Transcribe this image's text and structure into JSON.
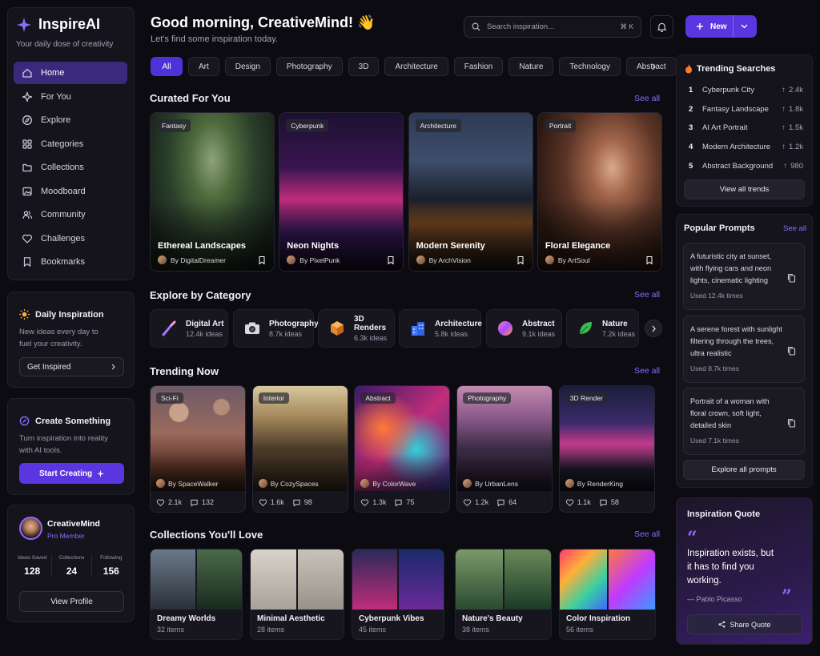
{
  "app": {
    "name": "InspireAI",
    "tagline": "Your daily dose of creativity"
  },
  "nav": [
    {
      "label": "Home",
      "icon": "home-icon",
      "active": true
    },
    {
      "label": "For You",
      "icon": "sparkle-icon"
    },
    {
      "label": "Explore",
      "icon": "compass-icon"
    },
    {
      "label": "Categories",
      "icon": "grid-icon"
    },
    {
      "label": "Collections",
      "icon": "folder-icon"
    },
    {
      "label": "Moodboard",
      "icon": "image-icon"
    },
    {
      "label": "Community",
      "icon": "users-icon"
    },
    {
      "label": "Challenges",
      "icon": "heart-icon"
    },
    {
      "label": "Bookmarks",
      "icon": "bookmark-icon"
    }
  ],
  "daily": {
    "title": "Daily Inspiration",
    "text1": "New ideas every day to",
    "text2": "fuel your creativity.",
    "button": "Get Inspired"
  },
  "create": {
    "title": "Create Something",
    "text1": "Turn inspiration into reality",
    "text2": "with AI tools.",
    "button": "Start Creating"
  },
  "profile": {
    "name": "CreativeMind",
    "role": "Pro Member",
    "stats": [
      {
        "label": "Ideas Saved",
        "value": "128"
      },
      {
        "label": "Collections",
        "value": "24"
      },
      {
        "label": "Following",
        "value": "156"
      }
    ],
    "button": "View Profile"
  },
  "header": {
    "greeting": "Good morning, CreativeMind! 👋",
    "subtitle": "Let's find some inspiration today.",
    "search_placeholder": "Search inspiration...",
    "shortcut": "⌘ K",
    "new_label": "New"
  },
  "chips": [
    "All",
    "Art",
    "Design",
    "Photography",
    "3D",
    "Architecture",
    "Fashion",
    "Nature",
    "Technology",
    "Abstract"
  ],
  "sections": {
    "curated": "Curated For You",
    "category": "Explore by Category",
    "trending": "Trending Now",
    "collections": "Collections You'll Love",
    "see_all": "See all"
  },
  "curated": [
    {
      "tag": "Fantasy",
      "title": "Ethereal Landscapes",
      "author": "By DigitalDreamer"
    },
    {
      "tag": "Cyberpunk",
      "title": "Neon Nights",
      "author": "By PixelPunk"
    },
    {
      "tag": "Architecture",
      "title": "Modern Serenity",
      "author": "By ArchVision"
    },
    {
      "tag": "Portrait",
      "title": "Floral Elegance",
      "author": "By ArtSoul"
    }
  ],
  "categories": [
    {
      "name": "Digital Art",
      "count": "12.4k ideas",
      "icon": "brush-icon"
    },
    {
      "name": "Photography",
      "count": "8.7k ideas",
      "icon": "camera-icon"
    },
    {
      "name": "3D Renders",
      "count": "6.3k ideas",
      "icon": "cube-icon"
    },
    {
      "name": "Architecture",
      "count": "5.8k ideas",
      "icon": "building-icon"
    },
    {
      "name": "Abstract",
      "count": "9.1k ideas",
      "icon": "orb-icon"
    },
    {
      "name": "Nature",
      "count": "7.2k ideas",
      "icon": "leaf-icon"
    }
  ],
  "trending": [
    {
      "tag": "Sci-Fi",
      "author": "By SpaceWalker",
      "likes": "2.1k",
      "comments": "132"
    },
    {
      "tag": "Interior",
      "author": "By CozySpaces",
      "likes": "1.6k",
      "comments": "98"
    },
    {
      "tag": "Abstract",
      "author": "By ColorWave",
      "likes": "1.3k",
      "comments": "75"
    },
    {
      "tag": "Photography",
      "author": "By UrbanLens",
      "likes": "1.2k",
      "comments": "64"
    },
    {
      "tag": "3D Render",
      "author": "By RenderKing",
      "likes": "1.1k",
      "comments": "58"
    }
  ],
  "collections": [
    {
      "title": "Dreamy Worlds",
      "count": "32 items"
    },
    {
      "title": "Minimal Aesthetic",
      "count": "28 items"
    },
    {
      "title": "Cyberpunk Vibes",
      "count": "45 items"
    },
    {
      "title": "Nature's Beauty",
      "count": "38 items"
    },
    {
      "title": "Color Inspiration",
      "count": "56 items"
    }
  ],
  "trending_searches": {
    "title": "Trending Searches",
    "items": [
      {
        "rank": "1",
        "query": "Cyberpunk City",
        "count": "2.4k"
      },
      {
        "rank": "2",
        "query": "Fantasy Landscape",
        "count": "1.8k"
      },
      {
        "rank": "3",
        "query": "AI Art Portrait",
        "count": "1.5k"
      },
      {
        "rank": "4",
        "query": "Modern Architecture",
        "count": "1.2k"
      },
      {
        "rank": "5",
        "query": "Abstract Background",
        "count": "980"
      }
    ],
    "button": "View all trends"
  },
  "popular_prompts": {
    "title": "Popular Prompts",
    "see_all": "See all",
    "items": [
      {
        "text": "A futuristic city at sunset, with flying cars and neon lights, cinematic lighting",
        "used": "Used 12.4k times"
      },
      {
        "text": "A serene forest with sunlight filtering through the trees, ultra realistic",
        "used": "Used 8.7k times"
      },
      {
        "text": "Portrait of a woman with floral crown, soft light, detailed skin",
        "used": "Used 7.1k times"
      }
    ],
    "button": "Explore all prompts"
  },
  "quote": {
    "title": "Inspiration Quote",
    "text": "Inspiration exists, but it has to find you working.",
    "author": "— Pablo Picasso",
    "button": "Share Quote"
  },
  "colors": {
    "accent": "#5a36e0",
    "link": "#8c6bff",
    "bg": "#0c0b11"
  }
}
